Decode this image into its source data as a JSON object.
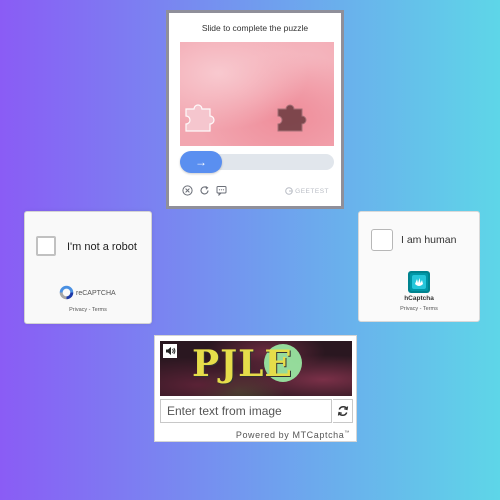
{
  "geetest": {
    "title": "Slide to complete the puzzle",
    "slider_arrow": "→",
    "brand": "GEETEST",
    "icons": [
      "close-circle-icon",
      "refresh-icon",
      "feedback-icon"
    ],
    "accent": "#5a8ff0"
  },
  "recaptcha": {
    "label": "I'm not a robot",
    "brand": "reCAPTCHA",
    "links": "Privacy - Terms"
  },
  "hcaptcha": {
    "label": "I am human",
    "brand": "hCaptcha",
    "links": "Privacy - Terms"
  },
  "mtcaptcha": {
    "captcha_text": "PJLE",
    "input_placeholder": "Enter text from image",
    "footer": "Powered by MTCaptcha",
    "footer_tm": "™"
  }
}
